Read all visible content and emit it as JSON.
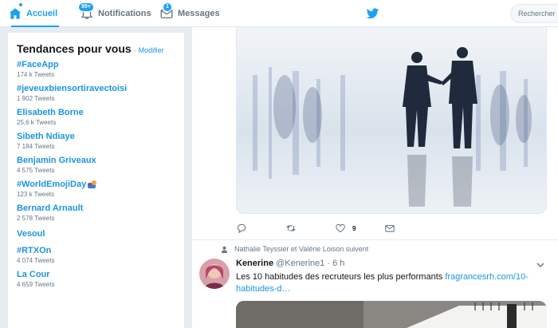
{
  "nav": {
    "home_label": "Accueil",
    "notifications_label": "Notifications",
    "notifications_badge": "99+",
    "messages_label": "Messages",
    "messages_badge": "1",
    "search_placeholder": "Rechercher"
  },
  "trends": {
    "title": "Tendances pour vous",
    "separator": "·",
    "edit_label": "Modifier",
    "items": [
      {
        "name": "#FaceApp",
        "count": "174 k Tweets"
      },
      {
        "name": "#jeveuxbiensortiravectoisi",
        "count": "1 902 Tweets"
      },
      {
        "name": "Elisabeth Borne",
        "count": "25,6 k Tweets"
      },
      {
        "name": "Sibeth Ndiaye",
        "count": "7 184 Tweets"
      },
      {
        "name": "Benjamin Griveaux",
        "count": "4 575 Tweets"
      },
      {
        "name": "#WorldEmojiDay",
        "count": "123 k Tweets"
      },
      {
        "name": "Bernard Arnault",
        "count": "2 578 Tweets"
      },
      {
        "name": "Vesoul",
        "count": ""
      },
      {
        "name": "#RTXOn",
        "count": "4 074 Tweets"
      },
      {
        "name": "La Cour",
        "count": "4 659 Tweets"
      }
    ]
  },
  "tweet1": {
    "like_count": "9"
  },
  "tweet2": {
    "context": "Nathalie Teyssier et Valérie Loison suivent",
    "name": "Kenerine",
    "handle": "@Kenerine1",
    "time": "· 6 h",
    "text": "Les 10 habitudes des recruteurs les plus performants ",
    "link": "fragrancesrh.com/10-habitudes-d…"
  },
  "colors": {
    "accent": "#1da1f2",
    "link": "#1b95e0",
    "background": "#e6ecf0"
  },
  "icons": [
    "home-icon",
    "bell-icon",
    "envelope-icon",
    "twitter-bird-icon",
    "reply-icon",
    "retweet-icon",
    "heart-icon",
    "mail-icon",
    "person-icon",
    "chevron-down-icon"
  ]
}
